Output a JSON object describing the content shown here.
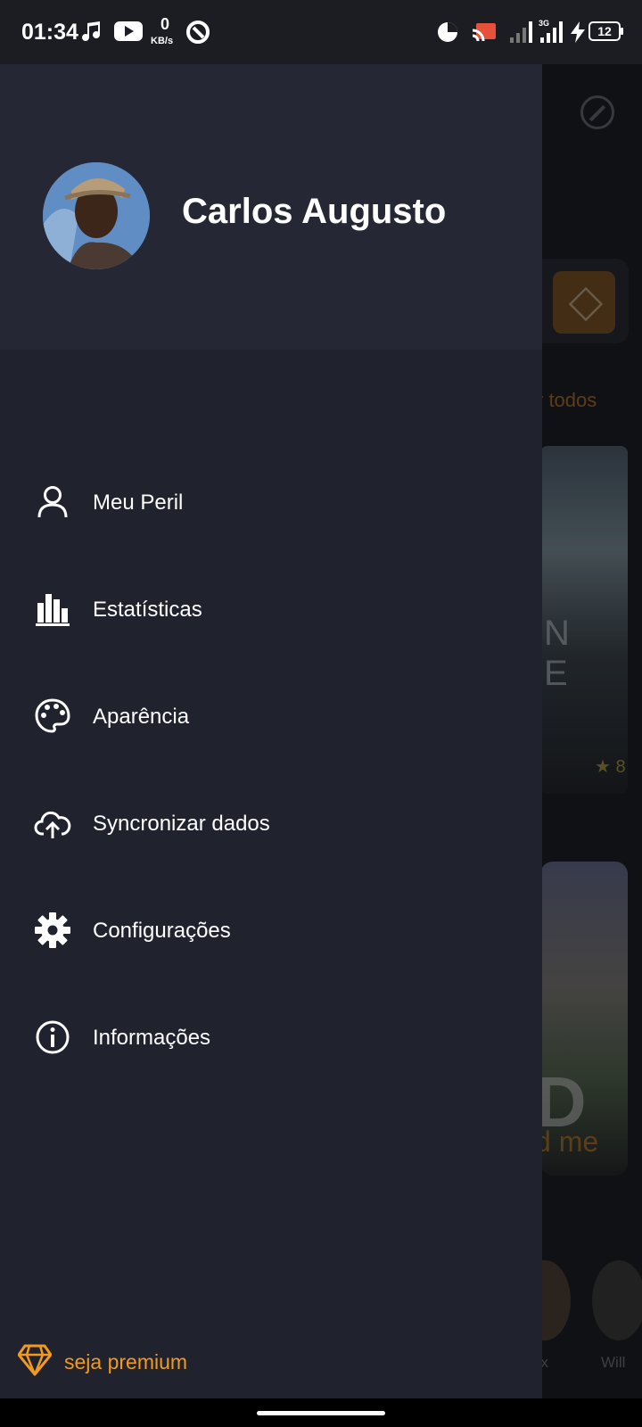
{
  "status_bar": {
    "time": "01:34",
    "net_speed_value": "0",
    "net_speed_unit": "KB/s",
    "network_type": "3G",
    "battery": "12"
  },
  "background": {
    "see_all_link": "r todos",
    "poster1_title_fragment": "N E",
    "poster1_rating": "★ 8",
    "poster2_title_fragment": "D",
    "poster2_subtitle_fragment": "d me",
    "cast1_name_fragment": "ox",
    "cast2_name_fragment": "Will"
  },
  "drawer": {
    "user_name": "Carlos Augusto",
    "menu": [
      {
        "label": "Meu Peril",
        "icon": "person-icon"
      },
      {
        "label": "Estatísticas",
        "icon": "bar-chart-icon"
      },
      {
        "label": "Aparência",
        "icon": "palette-icon"
      },
      {
        "label": "Syncronizar dados",
        "icon": "cloud-upload-icon"
      },
      {
        "label": "Configurações",
        "icon": "gear-icon"
      },
      {
        "label": "Informações",
        "icon": "info-icon"
      }
    ],
    "premium_label": "seja premium"
  },
  "colors": {
    "drawer_bg": "#20222e",
    "header_bg": "#252834",
    "accent": "#f29a1e"
  }
}
